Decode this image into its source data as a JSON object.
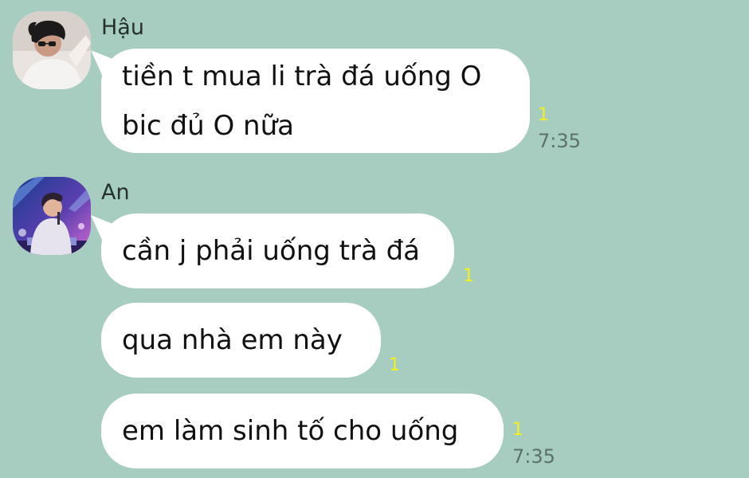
{
  "chat": {
    "colors": {
      "background": "#a7cdc1",
      "bubble": "#ffffff",
      "read_receipt": "#f1f01d",
      "timestamp": "#5c7169"
    },
    "groups": [
      {
        "sender": "Hậu",
        "avatar_icon": "user-photo-avatar",
        "messages": [
          {
            "text": "tiền t mua li trà đá uống O\nbic đủ O nữa",
            "unread": "1",
            "time": "7:35"
          }
        ]
      },
      {
        "sender": "An",
        "avatar_icon": "user-photo-avatar",
        "messages": [
          {
            "text": "cần j phải uống trà đá",
            "unread": "1"
          },
          {
            "text": "qua nhà em này",
            "unread": "1"
          },
          {
            "text": "em làm sinh tố cho uống",
            "unread": "1",
            "time": "7:35"
          }
        ]
      }
    ]
  }
}
